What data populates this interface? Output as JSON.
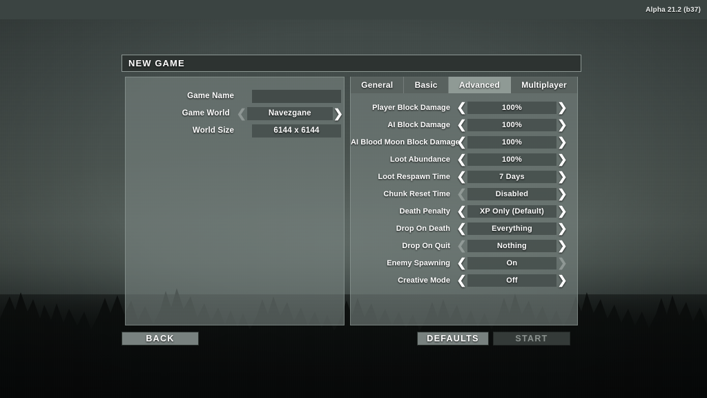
{
  "topbar": {
    "version": "Alpha 21.2 (b37)"
  },
  "window": {
    "title": "NEW GAME"
  },
  "left_panel": {
    "rows": [
      {
        "label": "Game Name",
        "value": "",
        "left_arrow": "none",
        "right_arrow": "none"
      },
      {
        "label": "Game World",
        "value": "Navezgane",
        "left_arrow": "disabled",
        "right_arrow": "enabled"
      },
      {
        "label": "World Size",
        "value": "6144 x 6144",
        "left_arrow": "none",
        "right_arrow": "none"
      }
    ]
  },
  "right_panel": {
    "tabs": [
      {
        "label": "General",
        "active": false
      },
      {
        "label": "Basic",
        "active": false
      },
      {
        "label": "Advanced",
        "active": true
      },
      {
        "label": "Multiplayer",
        "active": false
      }
    ],
    "settings": [
      {
        "label": "Player Block Damage",
        "value": "100%",
        "left_arrow": "enabled",
        "right_arrow": "enabled"
      },
      {
        "label": "AI Block Damage",
        "value": "100%",
        "left_arrow": "enabled",
        "right_arrow": "enabled"
      },
      {
        "label": "AI Blood Moon Block Damage",
        "value": "100%",
        "left_arrow": "enabled",
        "right_arrow": "enabled"
      },
      {
        "label": "Loot Abundance",
        "value": "100%",
        "left_arrow": "enabled",
        "right_arrow": "enabled"
      },
      {
        "label": "Loot Respawn Time",
        "value": "7 Days",
        "left_arrow": "enabled",
        "right_arrow": "enabled"
      },
      {
        "label": "Chunk Reset Time",
        "value": "Disabled",
        "left_arrow": "disabled",
        "right_arrow": "enabled"
      },
      {
        "label": "Death Penalty",
        "value": "XP Only (Default)",
        "left_arrow": "enabled",
        "right_arrow": "enabled"
      },
      {
        "label": "Drop On Death",
        "value": "Everything",
        "left_arrow": "enabled",
        "right_arrow": "enabled"
      },
      {
        "label": "Drop On Quit",
        "value": "Nothing",
        "left_arrow": "disabled",
        "right_arrow": "enabled"
      },
      {
        "label": "Enemy Spawning",
        "value": "On",
        "left_arrow": "enabled",
        "right_arrow": "disabled"
      },
      {
        "label": "Creative Mode",
        "value": "Off",
        "left_arrow": "enabled",
        "right_arrow": "enabled"
      }
    ]
  },
  "buttons": {
    "back": {
      "label": "BACK",
      "disabled": false
    },
    "defaults": {
      "label": "DEFAULTS",
      "disabled": false
    },
    "start": {
      "label": "START",
      "disabled": true
    }
  },
  "icons": {
    "left_chevron": "❮",
    "right_chevron": "❯"
  },
  "colors": {
    "panel_fill": "#78827f",
    "value_fill": "#464e4c",
    "tab_active": "#929d99",
    "title_bar": "#2d3331",
    "text": "#ffffff"
  }
}
